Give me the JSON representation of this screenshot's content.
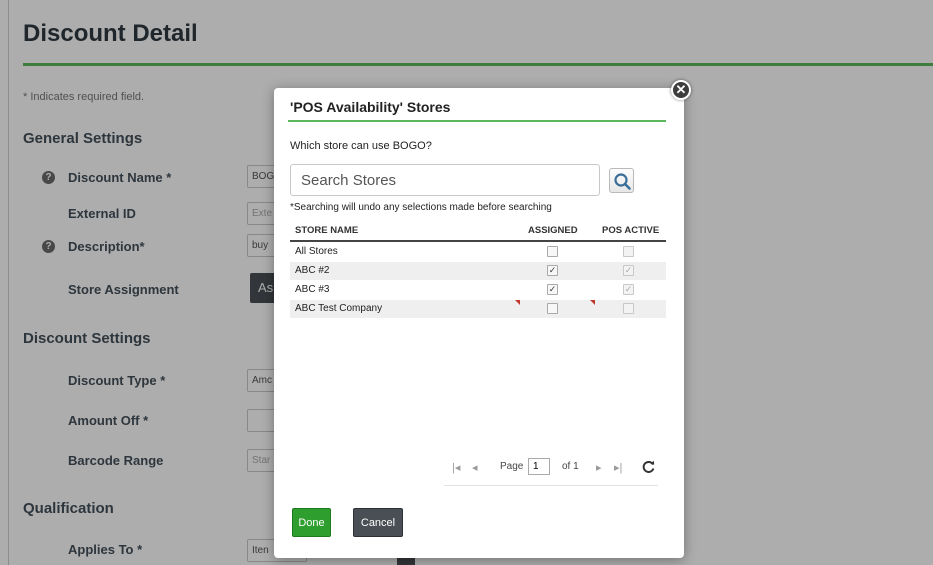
{
  "page": {
    "title": "Discount Detail",
    "required_note": "* Indicates required field.",
    "sections": {
      "general": "General Settings",
      "discount": "Discount Settings",
      "qualification": "Qualification"
    },
    "fields": {
      "discount_name": {
        "label": "Discount Name *",
        "value": "BOG"
      },
      "external_id": {
        "label": "External ID",
        "placeholder": "Exte"
      },
      "description": {
        "label": "Description*",
        "value": "buy"
      },
      "store_assignment": {
        "label": "Store Assignment",
        "button": "As"
      },
      "discount_type": {
        "label": "Discount Type *",
        "value": "Amc"
      },
      "amount_off": {
        "label": "Amount Off *",
        "value": ""
      },
      "barcode_range": {
        "label": "Barcode Range",
        "placeholder": "Star"
      },
      "applies_to": {
        "label": "Applies To *",
        "value": "Iten"
      }
    },
    "help_glyph": "?"
  },
  "modal": {
    "title": "'POS Availability' Stores",
    "question": "Which store can use BOGO?",
    "search_placeholder": "Search Stores",
    "search_note": "*Searching will undo any selections made before searching",
    "close_glyph": "✕",
    "columns": {
      "store_name": "STORE NAME",
      "assigned": "ASSIGNED",
      "pos_active": "POS ACTIVE"
    },
    "rows": [
      {
        "name": "All Stores",
        "assigned": false,
        "pos_active": false,
        "flagged": false
      },
      {
        "name": "ABC #2",
        "assigned": true,
        "pos_active": true,
        "flagged": false
      },
      {
        "name": "ABC #3",
        "assigned": true,
        "pos_active": true,
        "flagged": false
      },
      {
        "name": "ABC Test Company",
        "assigned": false,
        "pos_active": false,
        "flagged": true
      }
    ],
    "check_glyph": "✓",
    "pager": {
      "page_label": "Page",
      "page_value": "1",
      "of_label": "of 1",
      "icons": {
        "first": "first-page-icon",
        "prev": "prev-page-icon",
        "next": "next-page-icon",
        "last": "last-page-icon",
        "refresh": "refresh-icon"
      }
    },
    "buttons": {
      "done": "Done",
      "cancel": "Cancel"
    }
  },
  "colors": {
    "accent_green": "#5cb85c",
    "done_green": "#2e9e2e",
    "dark_button": "#4a4f55",
    "flag_red": "#c0392b"
  }
}
